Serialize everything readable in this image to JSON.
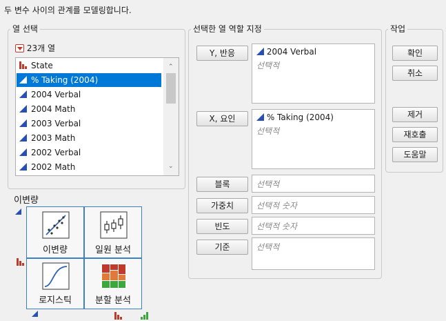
{
  "header": {
    "description": "두 변수 사이의 관계를 모델링합니다."
  },
  "column_select": {
    "legend": "열 선택",
    "count_label": "23개 열",
    "columns": [
      {
        "label": "State",
        "type": "nominal",
        "selected": false
      },
      {
        "label": "% Taking (2004)",
        "type": "continuous",
        "selected": true
      },
      {
        "label": "2004 Verbal",
        "type": "continuous",
        "selected": false
      },
      {
        "label": "2004 Math",
        "type": "continuous",
        "selected": false
      },
      {
        "label": "2003 Verbal",
        "type": "continuous",
        "selected": false
      },
      {
        "label": "2003 Math",
        "type": "continuous",
        "selected": false
      },
      {
        "label": "2002 Verbal",
        "type": "continuous",
        "selected": false
      },
      {
        "label": "2002 Math",
        "type": "continuous",
        "selected": false
      }
    ]
  },
  "roles": {
    "legend": "선택한 열 역할 지정",
    "y": {
      "button": "Y, 반응",
      "value": "2004 Verbal",
      "placeholder": "선택적"
    },
    "x": {
      "button": "X, 요인",
      "value": "% Taking (2004)",
      "placeholder": "선택적"
    },
    "block": {
      "button": "블록",
      "placeholder": "선택적"
    },
    "weight": {
      "button": "가중치",
      "placeholder": "선택적 숫자"
    },
    "freq": {
      "button": "빈도",
      "placeholder": "선택적 숫자"
    },
    "by": {
      "button": "기준",
      "placeholder": "선택적"
    }
  },
  "actions": {
    "legend": "작업",
    "ok": "확인",
    "cancel": "취소",
    "remove": "제거",
    "recall": "재호출",
    "help": "도움말"
  },
  "platform": {
    "title": "이변량",
    "tiles": [
      {
        "label": "이변량",
        "icon": "scatterplot-icon"
      },
      {
        "label": "일원 분석",
        "icon": "oneway-icon"
      },
      {
        "label": "로지스틱",
        "icon": "logistic-curve-icon"
      },
      {
        "label": "분할 분석",
        "icon": "mosaic-icon"
      }
    ]
  },
  "colors": {
    "accent": "#0078d7",
    "continuous": "#2850b4",
    "nominal": "#c0392b",
    "ordinal": "#3aa83a"
  }
}
